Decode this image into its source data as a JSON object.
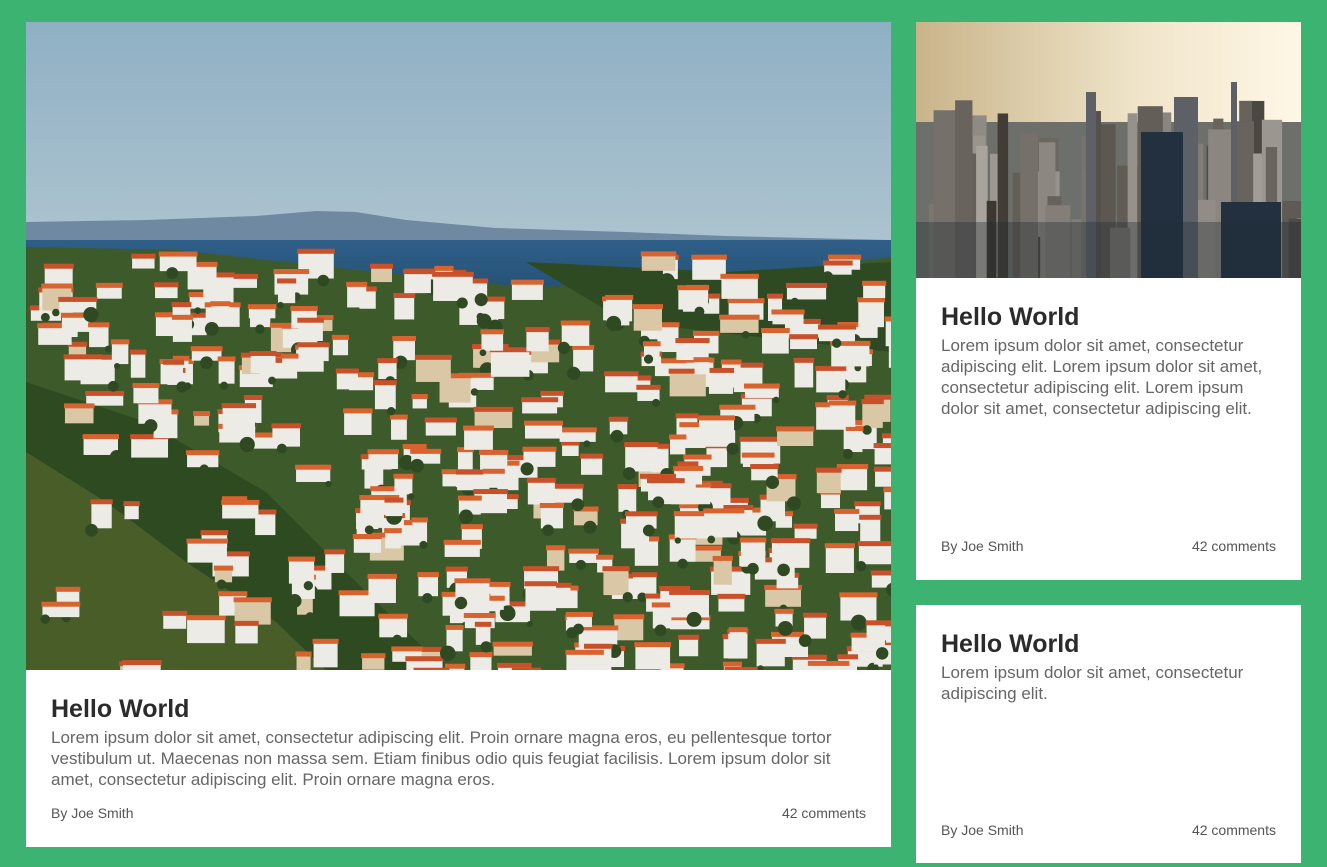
{
  "cards": [
    {
      "image": "coastal-town-photo",
      "title": "Hello World",
      "text": "Lorem ipsum dolor sit amet, consectetur adipiscing elit. Proin ornare magna eros, eu pellentesque tortor vestibulum ut. Maecenas non massa sem. Etiam finibus odio quis feugiat facilisis. Lorem ipsum dolor sit amet, consectetur adipiscing elit. Proin ornare magna eros.",
      "author": "By Joe Smith",
      "comments": "42 comments"
    },
    {
      "image": "city-skyline-photo",
      "title": "Hello World",
      "text": "Lorem ipsum dolor sit amet, consectetur adipiscing elit. Lorem ipsum dolor sit amet, consectetur adipiscing elit. Lorem ipsum dolor sit amet, consectetur adipiscing elit.",
      "author": "By Joe Smith",
      "comments": "42 comments"
    },
    {
      "title": "Hello World",
      "text": "Lorem ipsum dolor sit amet, consectetur adipiscing elit.",
      "author": "By Joe Smith",
      "comments": "42 comments"
    }
  ],
  "colors": {
    "background": "#3cb371",
    "card": "#ffffff",
    "title": "#2b2b2b",
    "text": "#666666"
  }
}
